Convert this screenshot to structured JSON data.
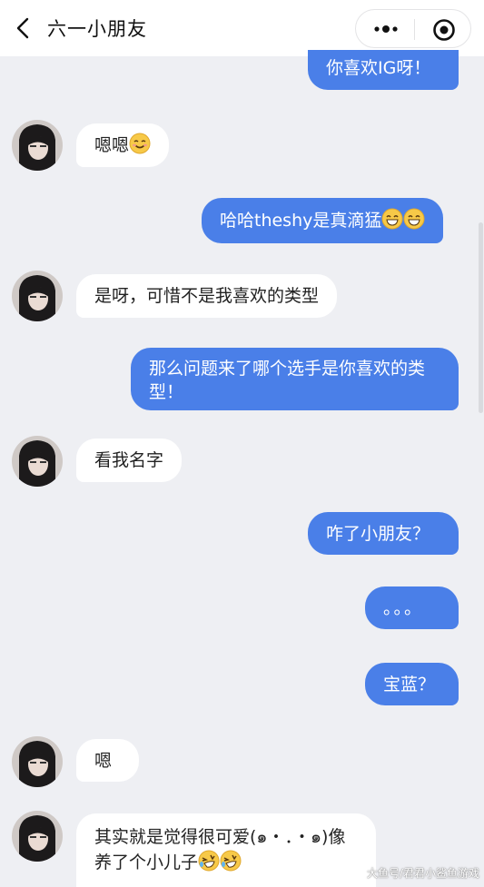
{
  "header": {
    "title": "六一小朋友",
    "back_icon": "chevron-left-icon",
    "more_icon": "more-dots-icon",
    "close_icon": "target-close-icon"
  },
  "messages": [
    {
      "side": "right",
      "text": "你喜欢IG呀！"
    },
    {
      "side": "left",
      "text": "嗯嗯",
      "emoji": [
        "smile"
      ]
    },
    {
      "side": "right",
      "text": "哈哈theshy是真滴猛",
      "emoji": [
        "grin",
        "grin"
      ]
    },
    {
      "side": "left",
      "text": "是呀，可惜不是我喜欢的类型"
    },
    {
      "side": "right",
      "text": "那么问题来了哪个选手是你喜欢的类型！"
    },
    {
      "side": "left",
      "text": "看我名字"
    },
    {
      "side": "right",
      "text": "咋了小朋友？"
    },
    {
      "side": "right",
      "text": "。。。"
    },
    {
      "side": "right",
      "text": "宝蓝？"
    },
    {
      "side": "left",
      "text": "嗯"
    },
    {
      "side": "left",
      "text": "其实就是觉得很可爱(๑・．・๑)像养了个小儿子",
      "emoji": [
        "rofl",
        "rofl"
      ]
    }
  ],
  "watermark": "大鱼号/君君小鲨鱼游戏",
  "colors": {
    "sent_bubble": "#4a7fe8",
    "received_bubble": "#ffffff",
    "background": "#eeeff3"
  }
}
